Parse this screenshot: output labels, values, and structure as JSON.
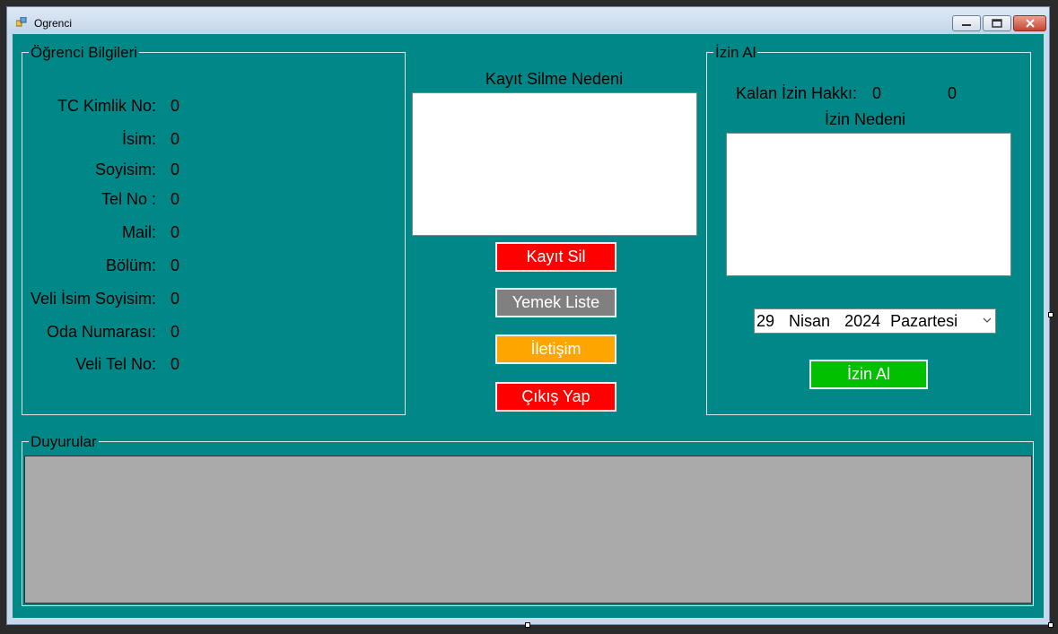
{
  "window": {
    "title": "Ogrenci",
    "minimize_label": "—",
    "maximize_label": "▭",
    "close_label": "✕"
  },
  "ogrenci_bilgileri": {
    "legend": "Öğrenci Bilgileri",
    "fields": [
      {
        "label": "TC Kimlik No:",
        "value": "0"
      },
      {
        "label": "İsim:",
        "value": "0"
      },
      {
        "label": "Soyisim:",
        "value": "0"
      },
      {
        "label": "Tel No :",
        "value": "0"
      },
      {
        "label": "Mail:",
        "value": "0"
      },
      {
        "label": "Bölüm:",
        "value": "0"
      },
      {
        "label": "Veli İsim Soyisim:",
        "value": "0"
      },
      {
        "label": "Oda Numarası:",
        "value": "0"
      },
      {
        "label": "Veli Tel No:",
        "value": "0"
      }
    ]
  },
  "kayit": {
    "silme_nedeni_label": "Kayıt Silme Nedeni",
    "silme_nedeni_value": ""
  },
  "buttons": {
    "kayit_sil": "Kayıt Sil",
    "yemek_liste": "Yemek Liste",
    "iletisim": "İletişim",
    "cikis_yap": "Çıkış Yap",
    "izin_al": "İzin Al"
  },
  "izin": {
    "legend": "İzin Al",
    "kalan_label": "Kalan İzin Hakkı:",
    "kalan_value_1": "0",
    "kalan_value_2": "0",
    "neden_label": "İzin Nedeni",
    "neden_value": "",
    "date_day": "29",
    "date_month": "Nisan",
    "date_year": "2024",
    "date_weekday": "Pazartesi"
  },
  "duyurular": {
    "legend": "Duyurular"
  },
  "colors": {
    "background": "#008888",
    "kayit_sil": "#ff0000",
    "yemek_liste": "#808080",
    "iletisim": "#ffa500",
    "cikis_yap": "#ff0000",
    "izin_al": "#00c000",
    "duyuru_box": "#aaaaaa"
  }
}
